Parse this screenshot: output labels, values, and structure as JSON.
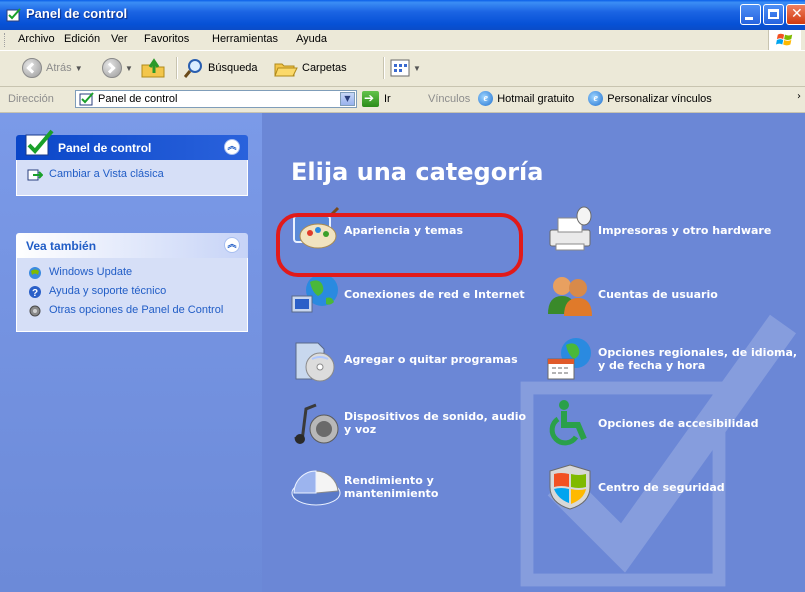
{
  "window": {
    "title": "Panel de control"
  },
  "menu": [
    "Archivo",
    "Edición",
    "Ver",
    "Favoritos",
    "Herramientas",
    "Ayuda"
  ],
  "toolbar": {
    "back": "Atrás",
    "search": "Búsqueda",
    "folders": "Carpetas"
  },
  "address": {
    "label": "Dirección",
    "value": "Panel de control",
    "go": "Ir"
  },
  "links": {
    "label": "Vínculos",
    "items": [
      "Hotmail gratuito",
      "Personalizar vínculos"
    ]
  },
  "sidebar": {
    "control_panel": {
      "title": "Panel de control",
      "items": [
        "Cambiar a Vista clásica"
      ]
    },
    "see_also": {
      "title": "Vea también",
      "items": [
        "Windows Update",
        "Ayuda y soporte técnico",
        "Otras opciones de Panel de Control"
      ]
    }
  },
  "main": {
    "heading": "Elija una categoría",
    "categories": [
      "Apariencia y temas",
      "Impresoras y otro hardware",
      "Conexiones de red e Internet",
      "Cuentas de usuario",
      "Agregar o quitar programas",
      "Opciones regionales, de idioma, y de fecha y hora",
      "Dispositivos de sonido, audio y voz",
      "Opciones de accesibilidad",
      "Rendimiento y mantenimiento",
      "Centro de seguridad"
    ]
  },
  "colors": {
    "highlight": "#e11a1a",
    "titlebar": "#0651d6",
    "content_bg": "#6b87d6",
    "link": "#215dc6"
  }
}
